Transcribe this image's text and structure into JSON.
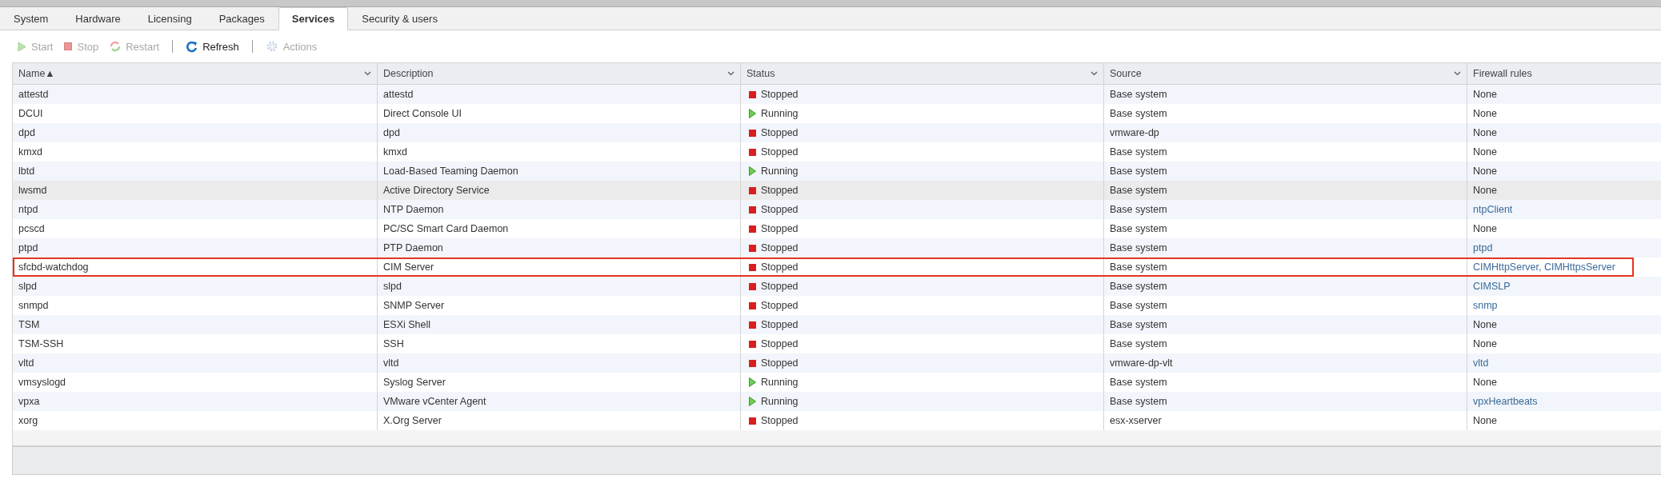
{
  "tabs": [
    {
      "label": "System",
      "selected": false
    },
    {
      "label": "Hardware",
      "selected": false
    },
    {
      "label": "Licensing",
      "selected": false
    },
    {
      "label": "Packages",
      "selected": false
    },
    {
      "label": "Services",
      "selected": true
    },
    {
      "label": "Security & users",
      "selected": false
    }
  ],
  "toolbar": [
    {
      "kind": "start",
      "label": "Start",
      "disabled": true,
      "separator_after": false
    },
    {
      "kind": "stop",
      "label": "Stop",
      "disabled": true,
      "separator_after": false
    },
    {
      "kind": "restart",
      "label": "Restart",
      "disabled": true,
      "separator_after": true
    },
    {
      "kind": "refresh",
      "label": "Refresh",
      "disabled": false,
      "separator_after": true
    },
    {
      "kind": "actions",
      "label": "Actions",
      "disabled": true,
      "separator_after": false
    }
  ],
  "table": {
    "columns": [
      {
        "label": "Name",
        "sort_indicator": "▲",
        "menu": true
      },
      {
        "label": "Description",
        "menu": true
      },
      {
        "label": "Status",
        "menu": true
      },
      {
        "label": "Source",
        "menu": true
      },
      {
        "label": "Firewall rules",
        "menu": false
      }
    ],
    "rows": [
      {
        "name": "attestd",
        "description": "attestd",
        "status": "Stopped",
        "kind": "stopped",
        "source": "Base system",
        "firewall": "None",
        "link": false,
        "selected": false,
        "highlighted": false
      },
      {
        "name": "DCUI",
        "description": "Direct Console UI",
        "status": "Running",
        "kind": "running",
        "source": "Base system",
        "firewall": "None",
        "link": false,
        "selected": false,
        "highlighted": false
      },
      {
        "name": "dpd",
        "description": "dpd",
        "status": "Stopped",
        "kind": "stopped",
        "source": "vmware-dp",
        "firewall": "None",
        "link": false,
        "selected": false,
        "highlighted": false
      },
      {
        "name": "kmxd",
        "description": "kmxd",
        "status": "Stopped",
        "kind": "stopped",
        "source": "Base system",
        "firewall": "None",
        "link": false,
        "selected": false,
        "highlighted": false
      },
      {
        "name": "lbtd",
        "description": "Load-Based Teaming Daemon",
        "status": "Running",
        "kind": "running",
        "source": "Base system",
        "firewall": "None",
        "link": false,
        "selected": false,
        "highlighted": false
      },
      {
        "name": "lwsmd",
        "description": "Active Directory Service",
        "status": "Stopped",
        "kind": "stopped",
        "source": "Base system",
        "firewall": "None",
        "link": false,
        "selected": true,
        "highlighted": false
      },
      {
        "name": "ntpd",
        "description": "NTP Daemon",
        "status": "Stopped",
        "kind": "stopped",
        "source": "Base system",
        "firewall": "ntpClient",
        "link": true,
        "selected": false,
        "highlighted": false
      },
      {
        "name": "pcscd",
        "description": "PC/SC Smart Card Daemon",
        "status": "Stopped",
        "kind": "stopped",
        "source": "Base system",
        "firewall": "None",
        "link": false,
        "selected": false,
        "highlighted": false
      },
      {
        "name": "ptpd",
        "description": "PTP Daemon",
        "status": "Stopped",
        "kind": "stopped",
        "source": "Base system",
        "firewall": "ptpd",
        "link": true,
        "selected": false,
        "highlighted": false
      },
      {
        "name": "sfcbd-watchdog",
        "description": "CIM Server",
        "status": "Stopped",
        "kind": "stopped",
        "source": "Base system",
        "firewall": "CIMHttpServer, CIMHttpsServer",
        "link": true,
        "selected": false,
        "highlighted": true
      },
      {
        "name": "slpd",
        "description": "slpd",
        "status": "Stopped",
        "kind": "stopped",
        "source": "Base system",
        "firewall": "CIMSLP",
        "link": true,
        "selected": false,
        "highlighted": false
      },
      {
        "name": "snmpd",
        "description": "SNMP Server",
        "status": "Stopped",
        "kind": "stopped",
        "source": "Base system",
        "firewall": "snmp",
        "link": true,
        "selected": false,
        "highlighted": false
      },
      {
        "name": "TSM",
        "description": "ESXi Shell",
        "status": "Stopped",
        "kind": "stopped",
        "source": "Base system",
        "firewall": "None",
        "link": false,
        "selected": false,
        "highlighted": false
      },
      {
        "name": "TSM-SSH",
        "description": "SSH",
        "status": "Stopped",
        "kind": "stopped",
        "source": "Base system",
        "firewall": "None",
        "link": false,
        "selected": false,
        "highlighted": false
      },
      {
        "name": "vltd",
        "description": "vltd",
        "status": "Stopped",
        "kind": "stopped",
        "source": "vmware-dp-vlt",
        "firewall": "vltd",
        "link": true,
        "selected": false,
        "highlighted": false
      },
      {
        "name": "vmsyslogd",
        "description": "Syslog Server",
        "status": "Running",
        "kind": "running",
        "source": "Base system",
        "firewall": "None",
        "link": false,
        "selected": false,
        "highlighted": false
      },
      {
        "name": "vpxa",
        "description": "VMware vCenter Agent",
        "status": "Running",
        "kind": "running",
        "source": "Base system",
        "firewall": "vpxHeartbeats",
        "link": true,
        "selected": false,
        "highlighted": false
      },
      {
        "name": "xorg",
        "description": "X.Org Server",
        "status": "Stopped",
        "kind": "stopped",
        "source": "esx-xserver",
        "firewall": "None",
        "link": false,
        "selected": false,
        "highlighted": false
      }
    ]
  }
}
